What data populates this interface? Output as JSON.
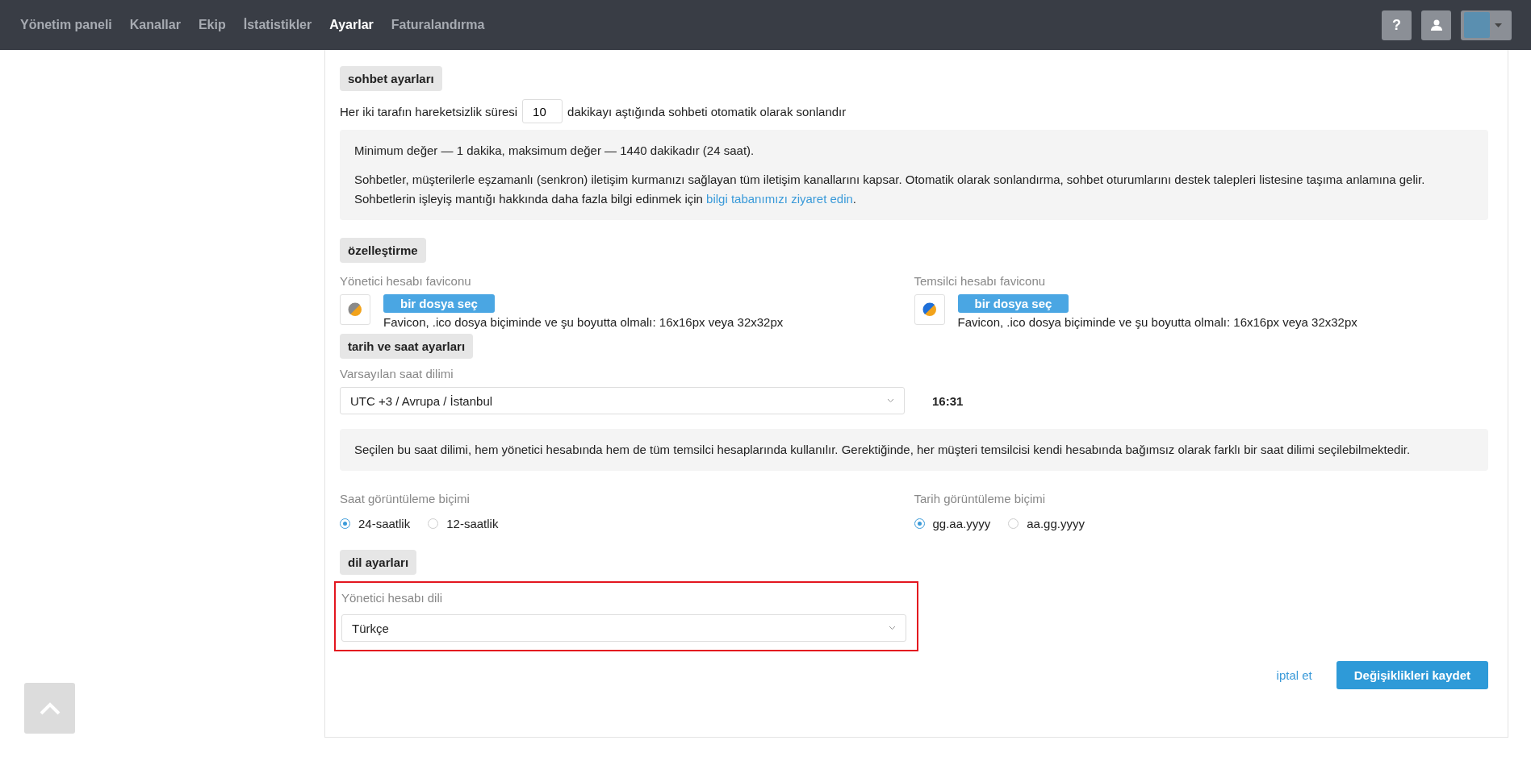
{
  "nav": {
    "tabs": [
      {
        "label": "Yönetim paneli",
        "selected": false
      },
      {
        "label": "Kanallar",
        "selected": false
      },
      {
        "label": "Ekip",
        "selected": false
      },
      {
        "label": "İstatistikler",
        "selected": false
      },
      {
        "label": "Ayarlar",
        "selected": true
      },
      {
        "label": "Faturalandırma",
        "selected": false
      }
    ],
    "help": "?"
  },
  "chat": {
    "header": "sohbet ayarları",
    "timeout_before": "Her iki tarafın hareketsizlik süresi",
    "timeout_value": "10",
    "timeout_after": "dakikayı aştığında sohbeti otomatik olarak sonlandır",
    "info_first": "Minimum değer — 1 dakika, maksimum değer — 1440 dakikadır (24 saat).",
    "info_second": "Sohbetler, müşterilerle eşzamanlı (senkron) iletişim kurmanızı sağlayan tüm iletişim kanallarını kapsar. Otomatik olarak sonlandırma, sohbet oturumlarını destek talepleri listesine taşıma anlamına gelir. Sohbetlerin işleyiş mantığı hakkında daha fazla bilgi edinmek için",
    "info_link": "bilgi tabanımızı ziyaret edin",
    "info_end": "."
  },
  "customization": {
    "header": "özelleştirme",
    "favicons": [
      {
        "label": "Yönetici hesabı faviconu",
        "color": "#8a8a8a",
        "button": "bir dosya seç",
        "hint": "Favicon, .ico dosya biçiminde ve şu boyutta olmalı: 16x16px veya 32x32px"
      },
      {
        "label": "Temsilci hesabı faviconu",
        "color": "#1e6fd9",
        "button": "bir dosya seç",
        "hint": "Favicon, .ico dosya biçiminde ve şu boyutta olmalı: 16x16px veya 32x32px"
      }
    ]
  },
  "datetime": {
    "header": "tarih ve saat ayarları",
    "timezone_label": "Varsayılan saat dilimi",
    "timezone_value": "UTC +3 / Avrupa / İstanbul",
    "current_time": "16:31",
    "info": "Seçilen bu saat dilimi, hem yönetici hesabında hem de tüm temsilci hesaplarında kullanılır. Gerektiğinde, her müşteri temsilcisi kendi hesabında bağımsız olarak farklı bir saat dilimi seçilebilmektedir.",
    "formats": [
      {
        "label": "Saat görüntüleme biçimi",
        "options": [
          {
            "label": "24-saatlik",
            "selected": true
          },
          {
            "label": "12-saatlik",
            "selected": false
          }
        ]
      },
      {
        "label": "Tarih görüntüleme biçimi",
        "options": [
          {
            "label": "gg.aa.yyyy",
            "selected": true
          },
          {
            "label": "aa.gg.yyyy",
            "selected": false
          }
        ]
      }
    ]
  },
  "language": {
    "header": "dil ayarları",
    "label": "Yönetici hesabı dili",
    "value": "Türkçe",
    "highlighted": true
  },
  "actions": {
    "cancel": "iptal et",
    "save": "Değişiklikleri kaydet"
  }
}
